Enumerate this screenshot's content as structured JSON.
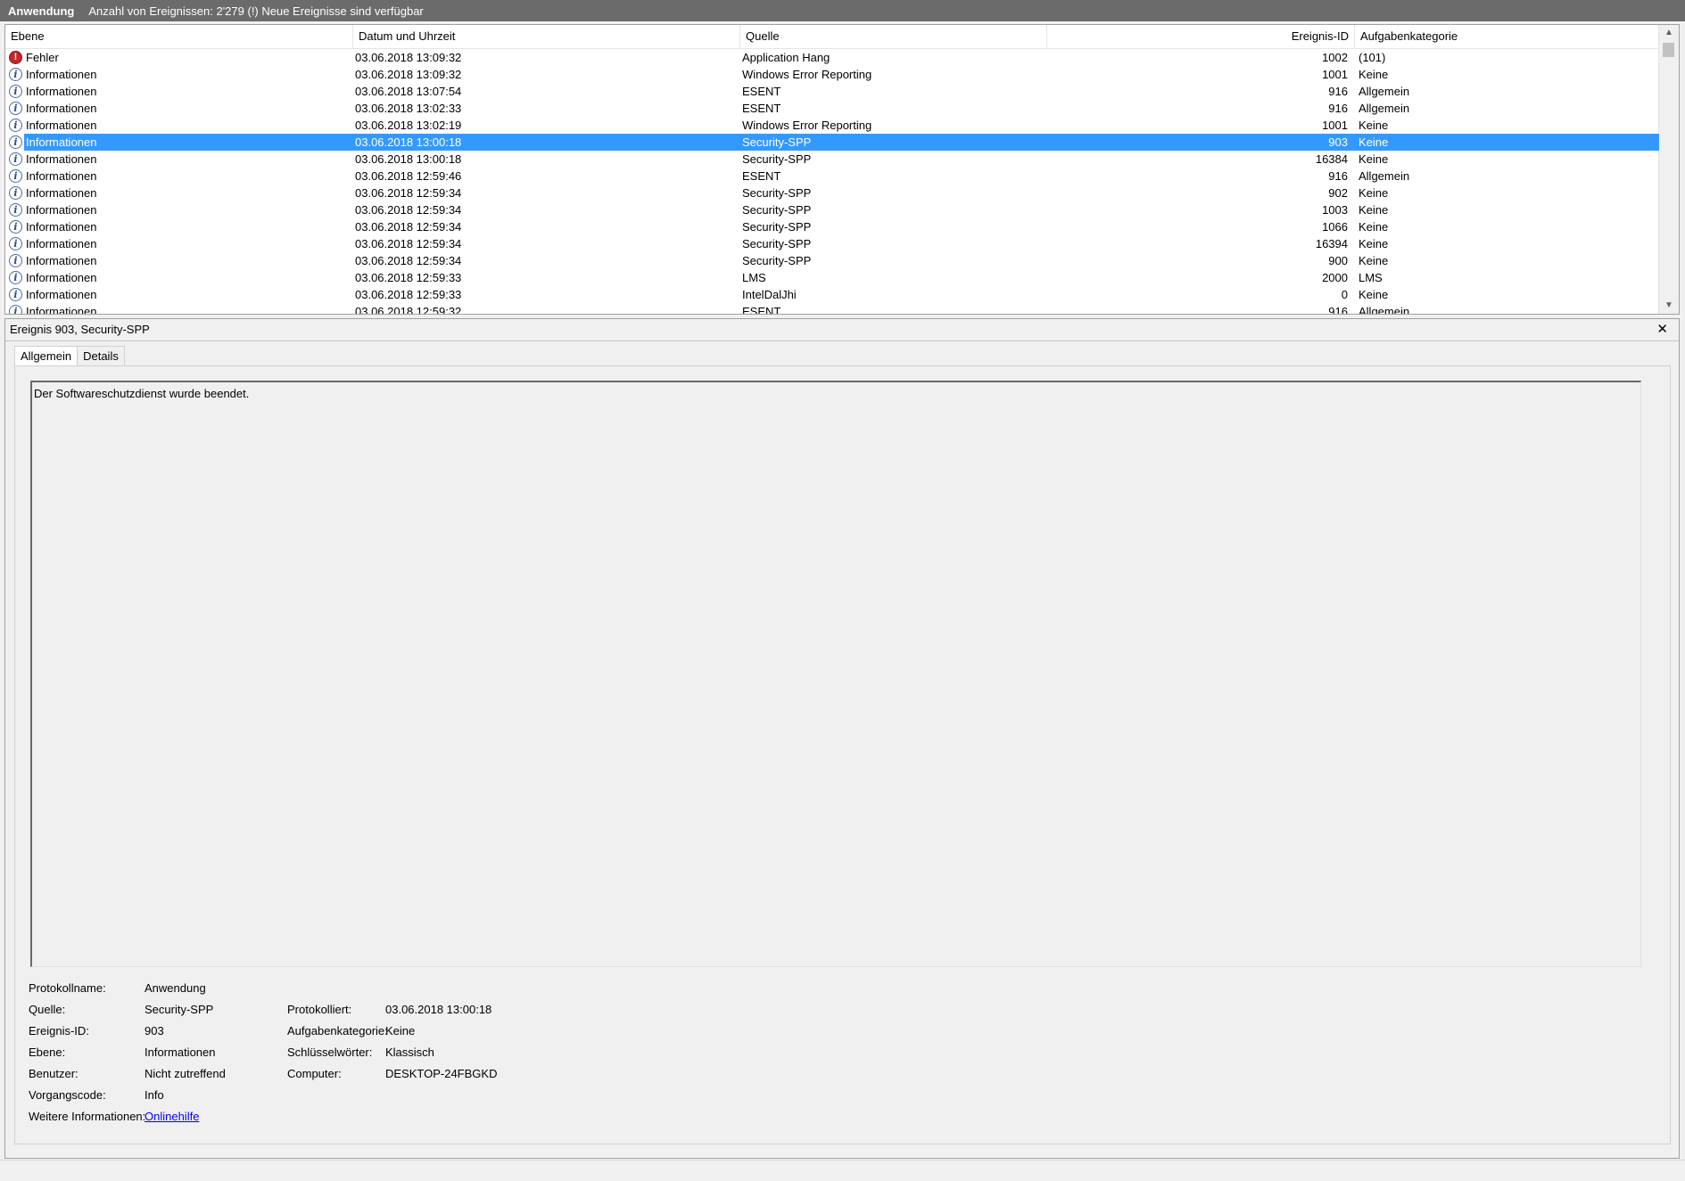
{
  "titlebar": {
    "log_name": "Anwendung",
    "info": "Anzahl von Ereignissen: 2'279 (!) Neue Ereignisse sind verfügbar"
  },
  "grid": {
    "columns": {
      "level": "Ebene",
      "date": "Datum und Uhrzeit",
      "source": "Quelle",
      "event_id": "Ereignis-ID",
      "category": "Aufgabenkategorie"
    },
    "rows": [
      {
        "level": "Fehler",
        "icon": "error-icon",
        "date": "03.06.2018 13:09:32",
        "source": "Application Hang",
        "id": "1002",
        "category": "(101)"
      },
      {
        "level": "Informationen",
        "icon": "info-icon",
        "date": "03.06.2018 13:09:32",
        "source": "Windows Error Reporting",
        "id": "1001",
        "category": "Keine"
      },
      {
        "level": "Informationen",
        "icon": "info-icon",
        "date": "03.06.2018 13:07:54",
        "source": "ESENT",
        "id": "916",
        "category": "Allgemein"
      },
      {
        "level": "Informationen",
        "icon": "info-icon",
        "date": "03.06.2018 13:02:33",
        "source": "ESENT",
        "id": "916",
        "category": "Allgemein"
      },
      {
        "level": "Informationen",
        "icon": "info-icon",
        "date": "03.06.2018 13:02:19",
        "source": "Windows Error Reporting",
        "id": "1001",
        "category": "Keine"
      },
      {
        "level": "Informationen",
        "icon": "info-icon",
        "date": "03.06.2018 13:00:18",
        "source": "Security-SPP",
        "id": "903",
        "category": "Keine",
        "selected": true
      },
      {
        "level": "Informationen",
        "icon": "info-icon",
        "date": "03.06.2018 13:00:18",
        "source": "Security-SPP",
        "id": "16384",
        "category": "Keine"
      },
      {
        "level": "Informationen",
        "icon": "info-icon",
        "date": "03.06.2018 12:59:46",
        "source": "ESENT",
        "id": "916",
        "category": "Allgemein"
      },
      {
        "level": "Informationen",
        "icon": "info-icon",
        "date": "03.06.2018 12:59:34",
        "source": "Security-SPP",
        "id": "902",
        "category": "Keine"
      },
      {
        "level": "Informationen",
        "icon": "info-icon",
        "date": "03.06.2018 12:59:34",
        "source": "Security-SPP",
        "id": "1003",
        "category": "Keine"
      },
      {
        "level": "Informationen",
        "icon": "info-icon",
        "date": "03.06.2018 12:59:34",
        "source": "Security-SPP",
        "id": "1066",
        "category": "Keine"
      },
      {
        "level": "Informationen",
        "icon": "info-icon",
        "date": "03.06.2018 12:59:34",
        "source": "Security-SPP",
        "id": "16394",
        "category": "Keine"
      },
      {
        "level": "Informationen",
        "icon": "info-icon",
        "date": "03.06.2018 12:59:34",
        "source": "Security-SPP",
        "id": "900",
        "category": "Keine"
      },
      {
        "level": "Informationen",
        "icon": "info-icon",
        "date": "03.06.2018 12:59:33",
        "source": "LMS",
        "id": "2000",
        "category": "LMS"
      },
      {
        "level": "Informationen",
        "icon": "info-icon",
        "date": "03.06.2018 12:59:33",
        "source": "IntelDalJhi",
        "id": "0",
        "category": "Keine"
      },
      {
        "level": "Informationen",
        "icon": "info-icon",
        "date": "03.06.2018 12:59:32",
        "source": "ESENT",
        "id": "916",
        "category": "Allgemein"
      }
    ]
  },
  "detail": {
    "title": "Ereignis 903, Security-SPP",
    "tabs": [
      "Allgemein",
      "Details"
    ],
    "message": "Der Softwareschutzdienst wurde beendet.",
    "labels": {
      "log_name": "Protokollname:",
      "source": "Quelle:",
      "event_id": "Ereignis-ID:",
      "level": "Ebene:",
      "user": "Benutzer:",
      "opcode": "Vorgangscode:",
      "more_info": "Weitere Informationen:",
      "logged": "Protokolliert:",
      "task_category": "Aufgabenkategorie:",
      "keywords": "Schlüsselwörter:",
      "computer": "Computer:"
    },
    "values": {
      "log_name": "Anwendung",
      "source": "Security-SPP",
      "event_id": "903",
      "level": "Informationen",
      "user": "Nicht zutreffend",
      "opcode": "Info",
      "more_info": "Onlinehilfe",
      "logged": "03.06.2018 13:00:18",
      "task_category": "Keine",
      "keywords": "Klassisch",
      "computer": "DESKTOP-24FBGKD"
    }
  },
  "colors": {
    "titlebar": "#6b6b6b",
    "selection": "#3399ff",
    "error": "#c0282b",
    "link": "#0000ee"
  }
}
